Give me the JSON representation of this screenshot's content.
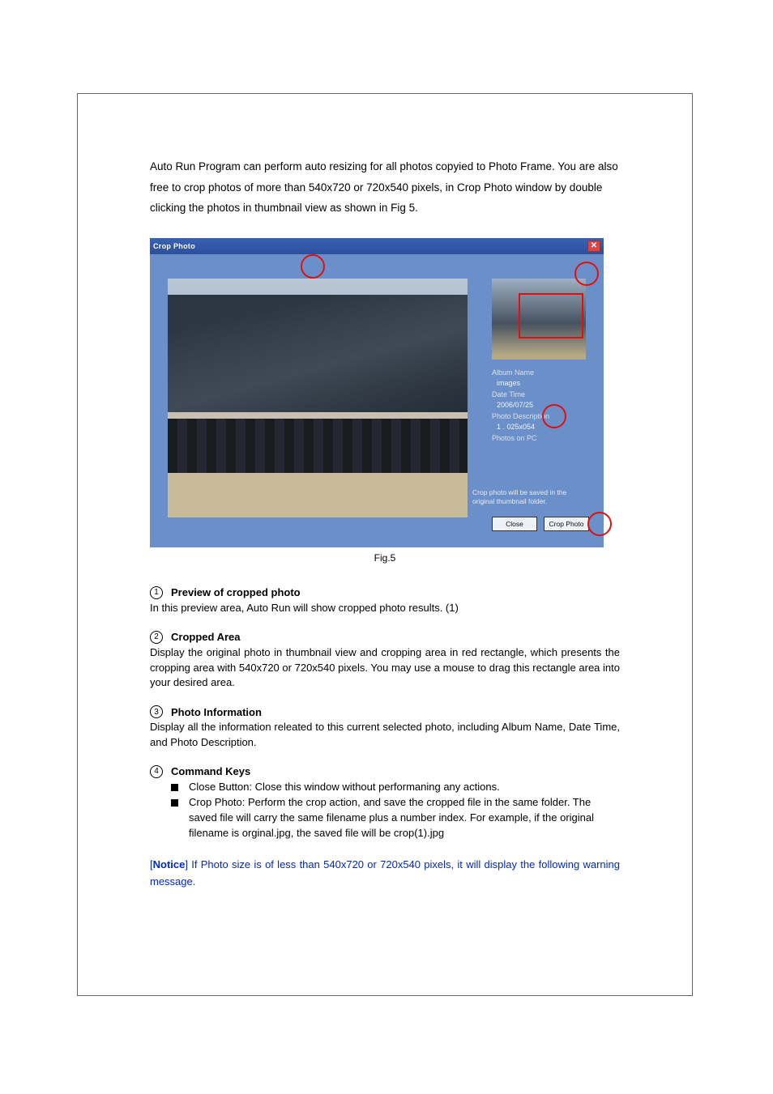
{
  "intro": "Auto Run Program can perform auto resizing for all photos copyied to Photo Frame. You are also free to crop photos of more than 540x720 or 720x540 pixels, in Crop Photo window by double clicking the photos in thumbnail view as shown in Fig 5.",
  "figure": {
    "window_title": "Crop Photo",
    "close_glyph": "✕",
    "info": {
      "album_label": "Album Name",
      "album_value": "images",
      "date_label": "Date Time",
      "date_value": "2006/07/25",
      "desc_label": "Photo Description",
      "desc_value": "1 . 025x054",
      "photos_label": "Photos on PC"
    },
    "save_note": "Crop photo will be saved in the original thumbnail folder.",
    "close_btn": "Close",
    "crop_btn": "Crop Photo",
    "caption": "Fig.5"
  },
  "sections": [
    {
      "num": "1",
      "title": "Preview of cropped photo",
      "body": "In this preview area, Auto Run will show cropped photo results. (1)"
    },
    {
      "num": "2",
      "title": "Cropped Area",
      "body": "Display the original photo in thumbnail view and cropping area in red rectangle, which presents the cropping area with 540x720 or 720x540 pixels. You may use a mouse to drag this rectangle area into your desired area."
    },
    {
      "num": "3",
      "title": "Photo Information",
      "body": "Display all the information releated to this current selected photo, including Album Name, Date Time, and Photo Description."
    },
    {
      "num": "4",
      "title": "Command Keys",
      "items": [
        "Close Button: Close this window without performaning any actions.",
        "Crop Photo: Perform the crop action, and save the cropped file in the same folder. The saved file will carry the same filename plus a number index. For example, if the original filename is orginal.jpg, the saved file will be crop(1).jpg"
      ]
    }
  ],
  "notice": {
    "prefix_open": "[",
    "word": "Notice",
    "prefix_close": "]",
    "text": " If Photo size is of less than 540x720 or 720x540 pixels, it will display the following warning message."
  }
}
